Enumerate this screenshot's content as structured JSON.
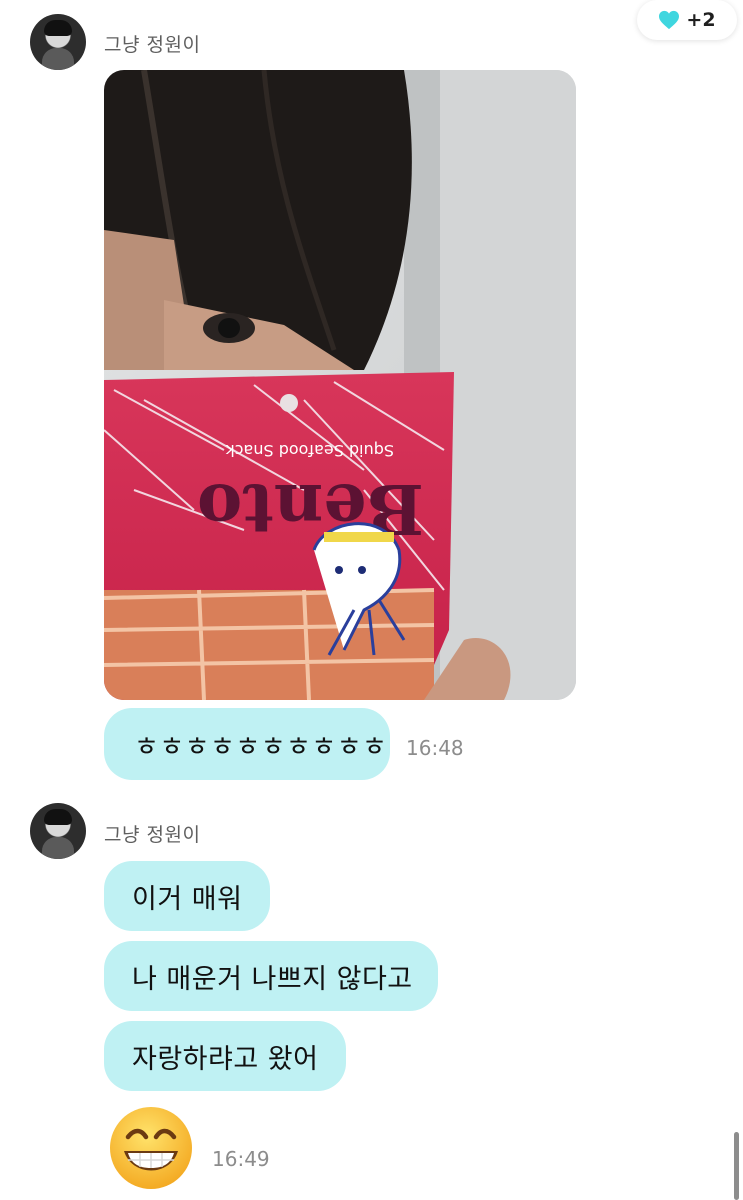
{
  "reaction": {
    "count": "+2",
    "icon": "heart-icon",
    "color": "#3fd6df"
  },
  "messages": {
    "group1": {
      "sender": "그냥 정원이",
      "text": "ㅎㅎㅎㅎㅎㅎㅎㅎㅎㅎ",
      "time": "16:48"
    },
    "group2": {
      "sender": "그냥 정원이",
      "bubbles": [
        "이거 매워",
        "나 매운거 나쁘지 않다고",
        "자랑하랴고 왔어"
      ],
      "emoji": "grinning-face-emoji",
      "time": "16:49"
    }
  },
  "photo": {
    "package_lines": [
      "Bento",
      "Squid Seafood Snack"
    ]
  },
  "colors": {
    "bubble": "#bff1f3",
    "time": "#8c8c8c",
    "sender": "#5f5f5f"
  }
}
